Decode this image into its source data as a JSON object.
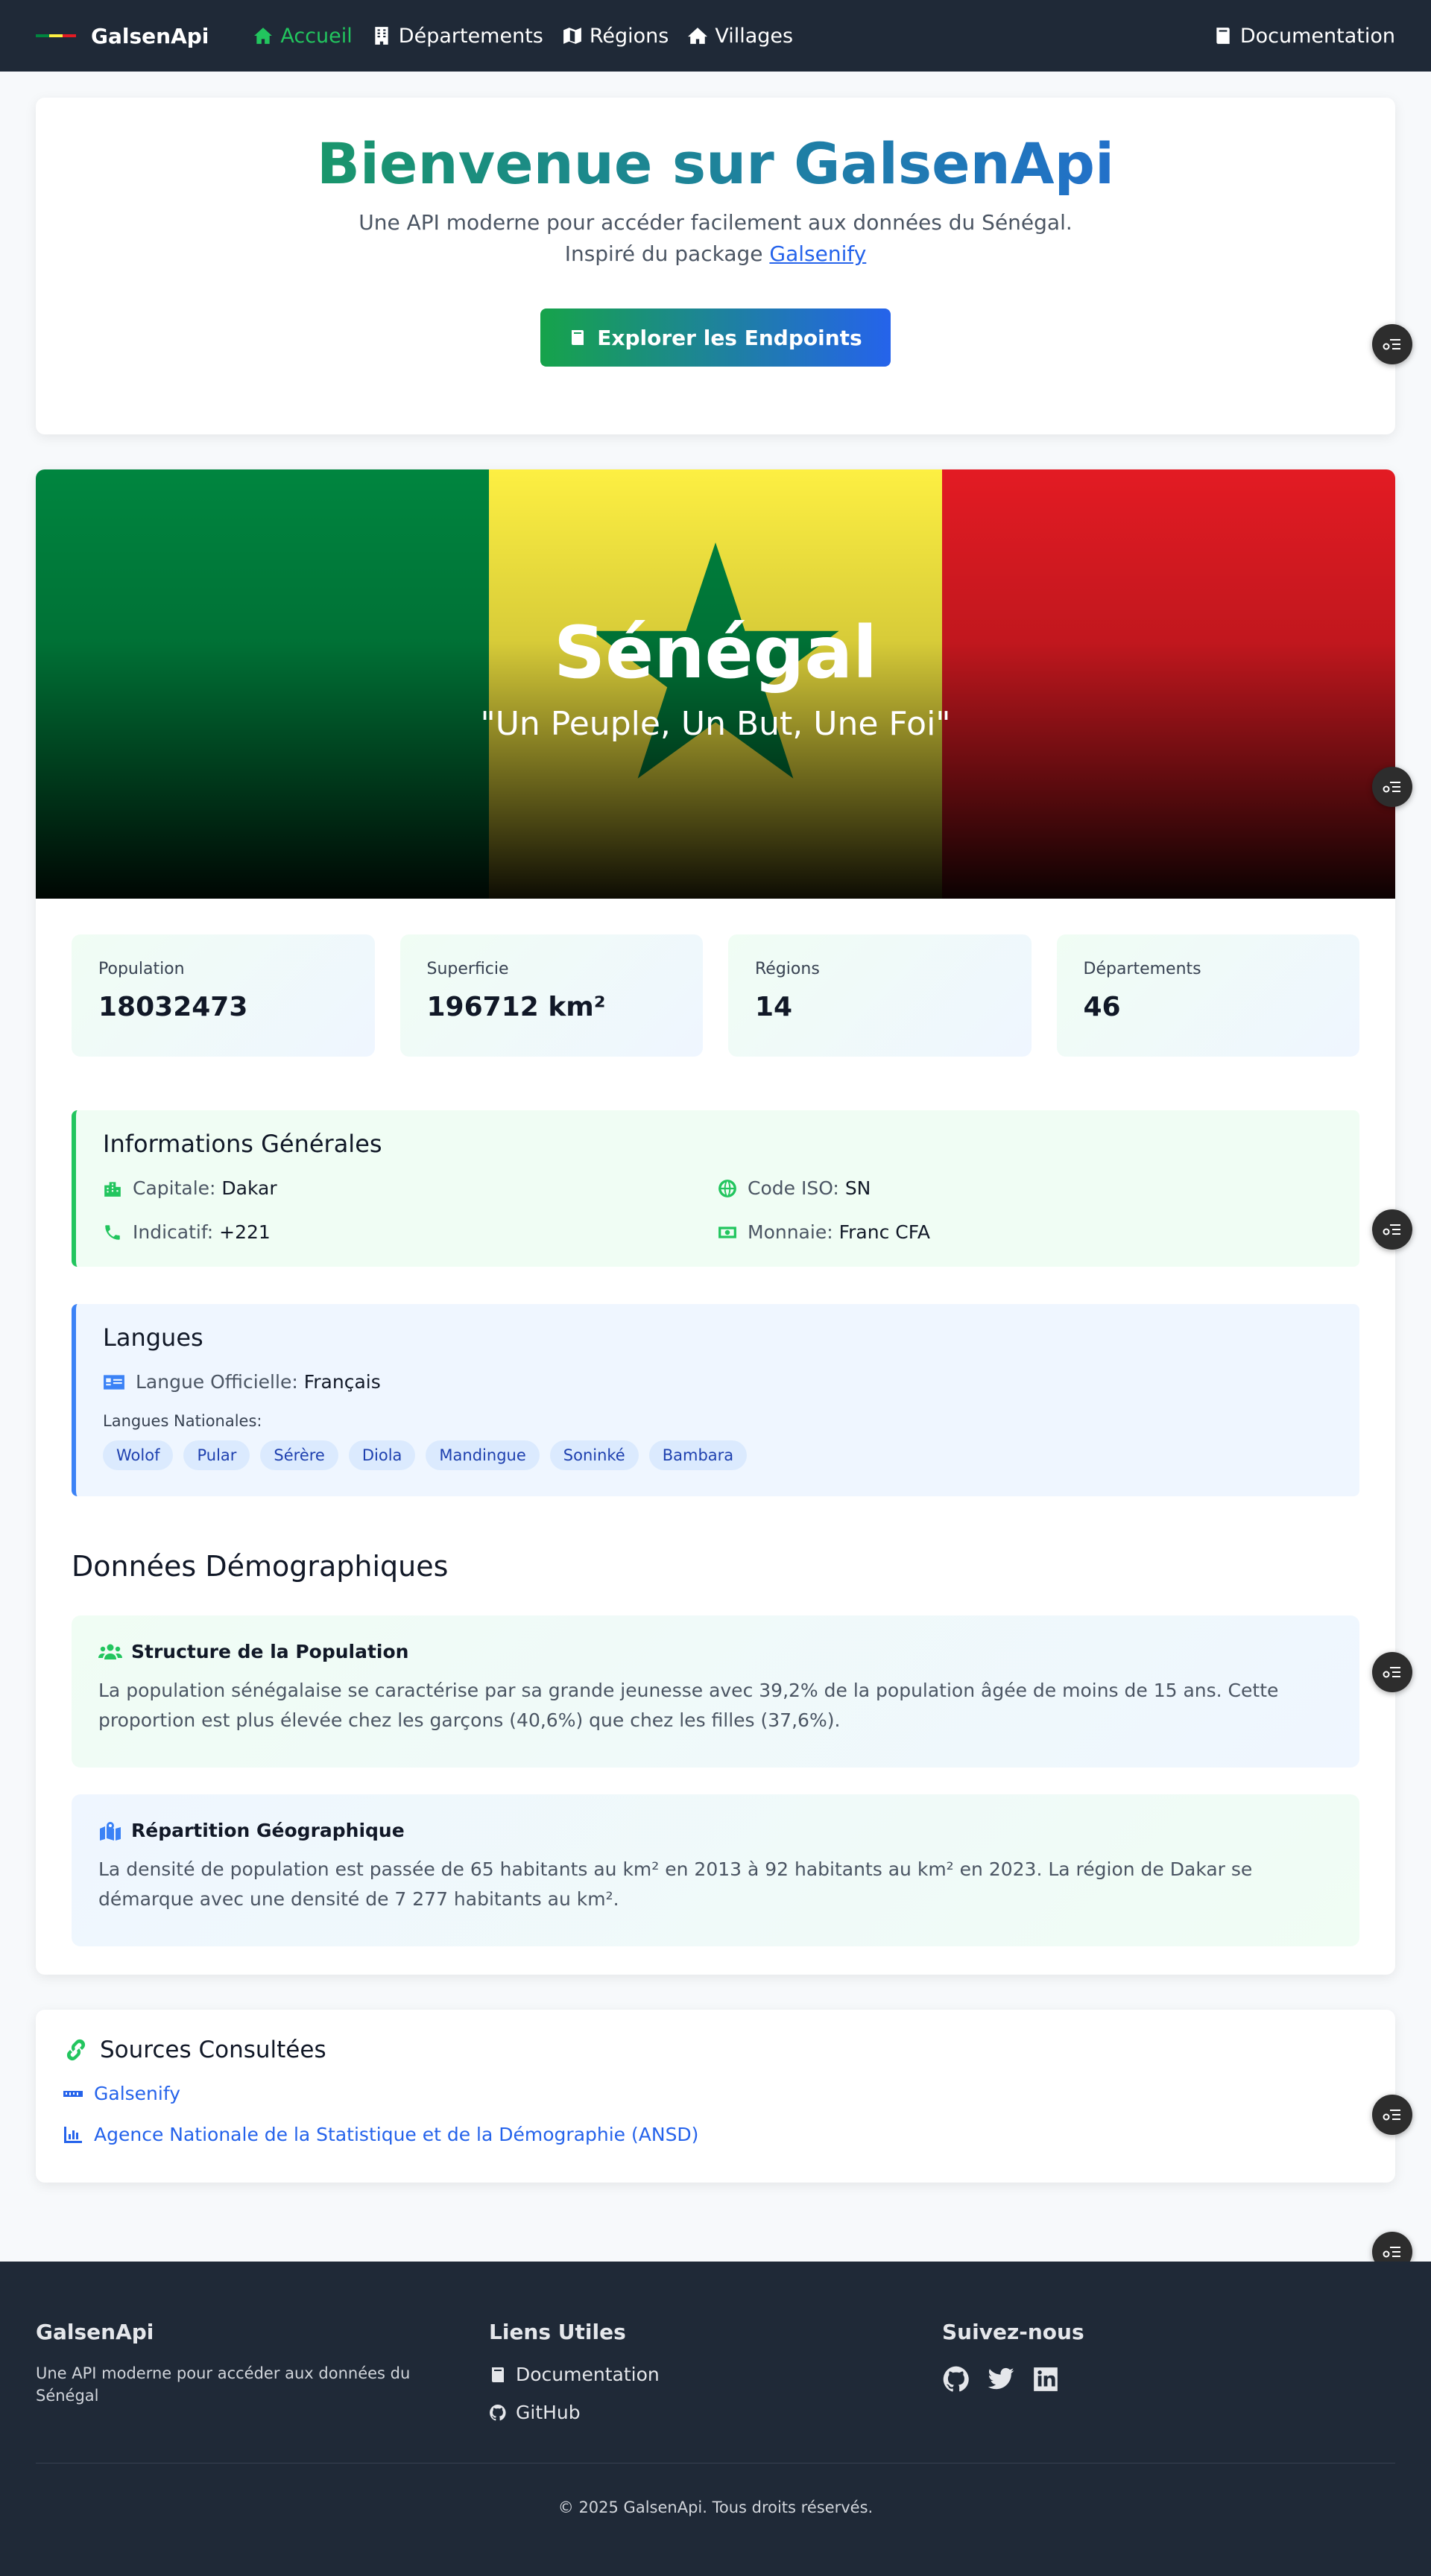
{
  "nav": {
    "brand": "GalsenApi",
    "links": [
      {
        "label": "Accueil",
        "icon": "home-icon"
      },
      {
        "label": "Départements",
        "icon": "building-icon"
      },
      {
        "label": "Régions",
        "icon": "map-icon"
      },
      {
        "label": "Villages",
        "icon": "house-icon"
      }
    ],
    "docs": "Documentation"
  },
  "hero": {
    "title": "Bienvenue sur GalsenApi",
    "subtitle": "Une API moderne pour accéder facilement aux données du Sénégal.",
    "inspired_prefix": "Inspiré du package",
    "inspired_link": "Galsenify",
    "cta": "Explorer les Endpoints"
  },
  "country": {
    "name": "Sénégal",
    "motto": "\"Un Peuple, Un But, Une Foi\"",
    "flag_colors": {
      "green": "#00853f",
      "yellow": "#fdef42",
      "red": "#e31b23"
    }
  },
  "stats": [
    {
      "label": "Population",
      "value": "18032473"
    },
    {
      "label": "Superficie",
      "value": "196712 km²"
    },
    {
      "label": "Régions",
      "value": "14"
    },
    {
      "label": "Départements",
      "value": "46"
    }
  ],
  "info": {
    "title": "Informations Générales",
    "capital_label": "Capitale:",
    "capital": "Dakar",
    "iso_label": "Code ISO:",
    "iso": "SN",
    "code_label": "Indicatif:",
    "code": "+221",
    "currency_label": "Monnaie:",
    "currency": "Franc CFA"
  },
  "langs": {
    "title": "Langues",
    "official_label": "Langue Officielle:",
    "official": "Français",
    "national_label": "Langues Nationales:",
    "national": [
      "Wolof",
      "Pular",
      "Sérère",
      "Diola",
      "Mandingue",
      "Soninké",
      "Bambara"
    ]
  },
  "demo": {
    "title": "Données Démographiques",
    "structure_title": "Structure de la Population",
    "structure_text": "La population sénégalaise se caractérise par sa grande jeunesse avec 39,2% de la population âgée de moins de 15 ans. Cette proportion est plus élevée chez les garçons (40,6%) que chez les filles (37,6%).",
    "geo_title": "Répartition Géographique",
    "geo_text": "La densité de population est passée de 65 habitants au km² en 2013 à 92 habitants au km² en 2023. La région de Dakar se démarque avec une densité de 7 277 habitants au km²."
  },
  "sources": {
    "title": "Sources Consultées",
    "items": [
      "Galsenify",
      "Agence Nationale de la Statistique et de la Démographie (ANSD)"
    ]
  },
  "footer": {
    "brand": "GalsenApi",
    "tagline": "Une API moderne pour accéder aux données du Sénégal",
    "links_title": "Liens Utiles",
    "links": [
      "Documentation",
      "GitHub"
    ],
    "follow_title": "Suivez-nous",
    "copyright": "© 2025 GalsenApi. Tous droits réservés."
  },
  "colors": {
    "accent_green": "#22c55e",
    "accent_blue": "#2563eb",
    "nav_bg": "#1f2937"
  }
}
